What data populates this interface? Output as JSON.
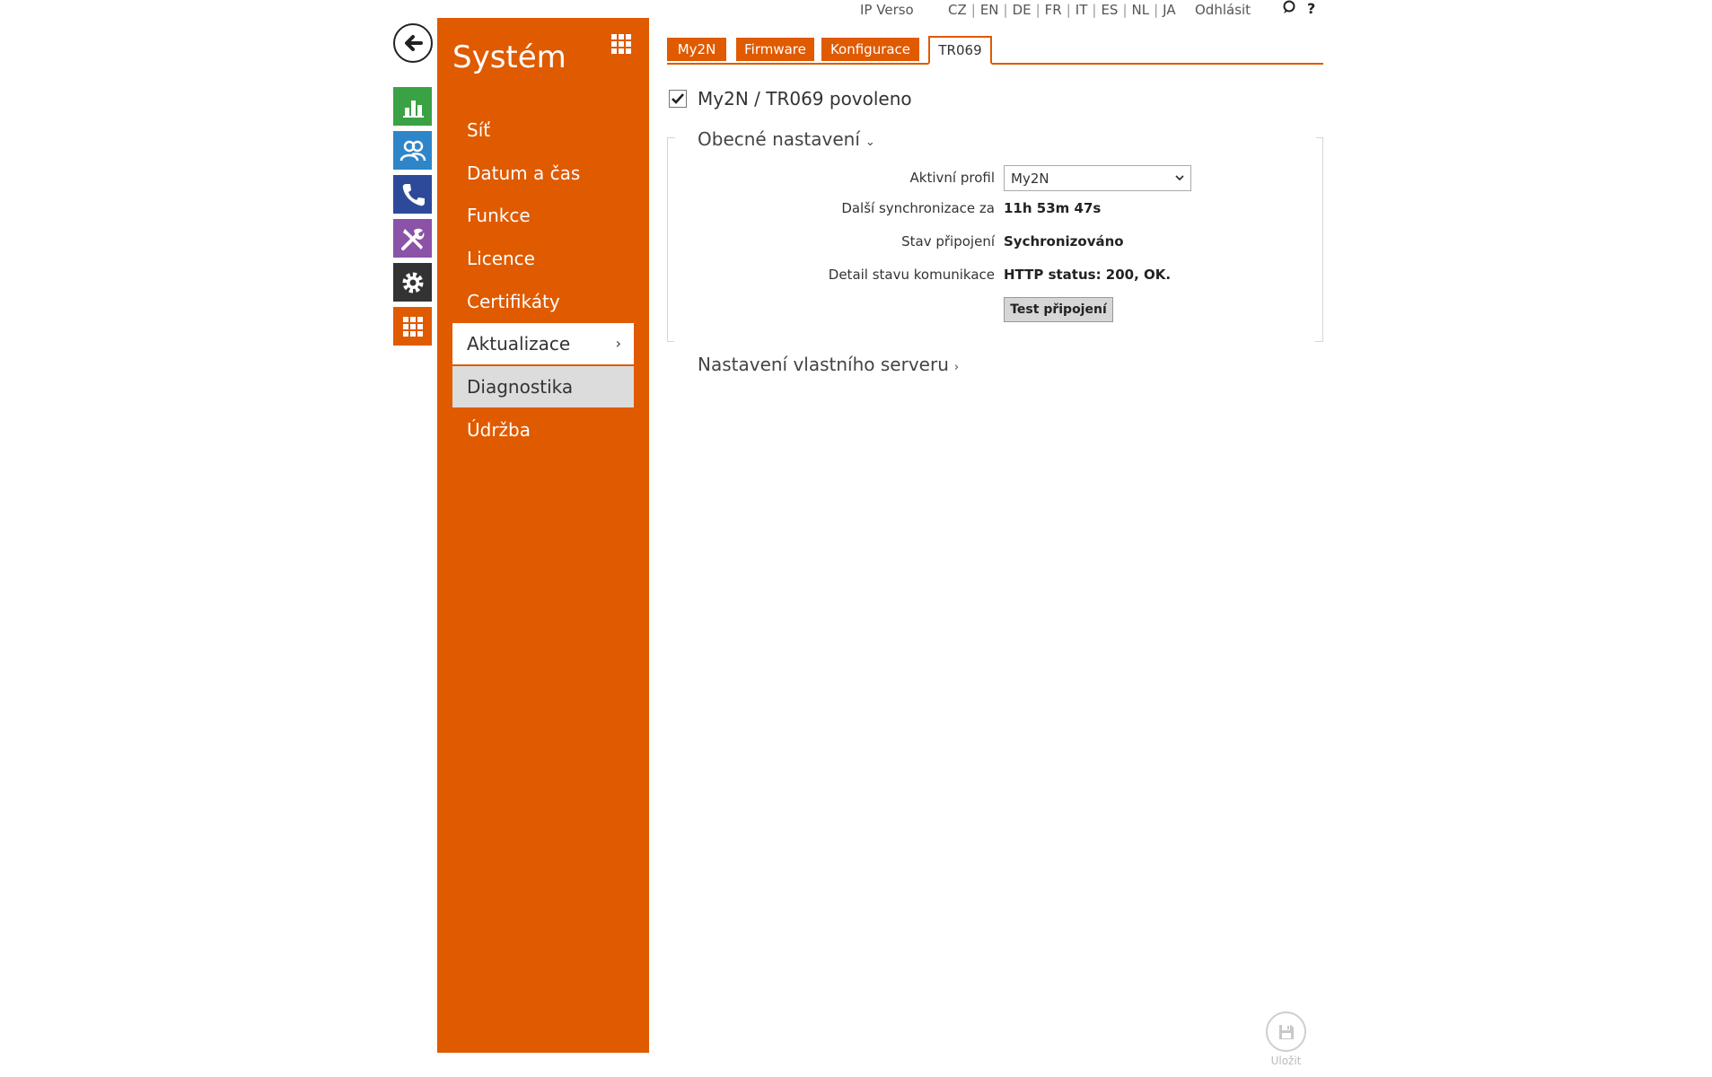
{
  "topbar": {
    "product": "IP Verso",
    "languages": [
      "CZ",
      "EN",
      "DE",
      "FR",
      "IT",
      "ES",
      "NL",
      "JA"
    ],
    "logout": "Odhlásit",
    "help_mark": "?"
  },
  "rail": {
    "icons": [
      "back-arrow-icon",
      "bar-chart-icon",
      "users-icon",
      "phone-icon",
      "tools-icon",
      "gear-icon",
      "grid-icon"
    ],
    "colors": {
      "status": "#3aa244",
      "directory": "#2e86c8",
      "calls": "#2d4a9a",
      "hardware": "#8c52a7",
      "services": "#333333",
      "system": "#e05a00"
    }
  },
  "sidebar": {
    "title": "Systém",
    "items": [
      {
        "label": "Síť",
        "state": "normal"
      },
      {
        "label": "Datum a čas",
        "state": "normal"
      },
      {
        "label": "Funkce",
        "state": "normal"
      },
      {
        "label": "Licence",
        "state": "normal"
      },
      {
        "label": "Certifikáty",
        "state": "normal"
      },
      {
        "label": "Aktualizace",
        "state": "active"
      },
      {
        "label": "Diagnostika",
        "state": "hover"
      },
      {
        "label": "Údržba",
        "state": "normal"
      }
    ],
    "accent_color": "#e05a00"
  },
  "tabs": [
    {
      "label": "My2N",
      "active": false
    },
    {
      "label": "Firmware",
      "active": false
    },
    {
      "label": "Konfigurace",
      "active": false
    },
    {
      "label": "TR069",
      "active": true
    }
  ],
  "main": {
    "enabled_label": "My2N / TR069 povoleno",
    "enabled_checked": true,
    "general_section": "Obecné nastavení",
    "fields": {
      "active_profile_label": "Aktivní profil",
      "active_profile_value": "My2N",
      "next_sync_label": "Další synchronizace za",
      "next_sync_value": "11h 53m 47s",
      "connection_state_label": "Stav připojení",
      "connection_state_value": "Sychronizováno",
      "comm_detail_label": "Detail stavu komunikace",
      "comm_detail_value": "HTTP status: 200, OK."
    },
    "test_button": "Test připojení",
    "custom_server_section": "Nastavení vlastního serveru"
  },
  "save": {
    "label": "Uložit"
  }
}
